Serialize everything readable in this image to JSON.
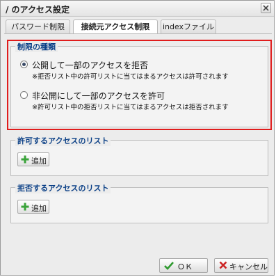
{
  "window": {
    "title": "/ のアクセス設定"
  },
  "tabs": [
    {
      "label": "パスワード制限",
      "active": false
    },
    {
      "label": "接続元アクセス制限",
      "active": true
    },
    {
      "label": "indexファイル",
      "active": false
    }
  ],
  "restriction": {
    "legend": "制限の種類",
    "options": [
      {
        "label": "公開して一部のアクセスを拒否",
        "note": "※拒否リスト中の許可リストに当てはまるアクセスは許可されます",
        "checked": true
      },
      {
        "label": "非公開にして一部のアクセスを許可",
        "note": "※許可リスト中の拒否リストに当てはまるアクセスは拒否されます",
        "checked": false
      }
    ]
  },
  "allow_list": {
    "legend": "許可するアクセスのリスト",
    "add_label": "追加"
  },
  "deny_list": {
    "legend": "拒否するアクセスのリスト",
    "add_label": "追加"
  },
  "footer": {
    "ok_label": "ＯＫ",
    "cancel_label": "キャンセル"
  },
  "colors": {
    "highlight_border": "#e01c1c",
    "legend_text": "#0a3f86",
    "ok_check": "#2f9a2f",
    "cancel_x": "#cc2222",
    "add_plus": "#3aa33a"
  },
  "icons": {
    "close": "close-icon",
    "add": "plus-icon",
    "ok": "check-icon",
    "cancel": "x-icon"
  }
}
